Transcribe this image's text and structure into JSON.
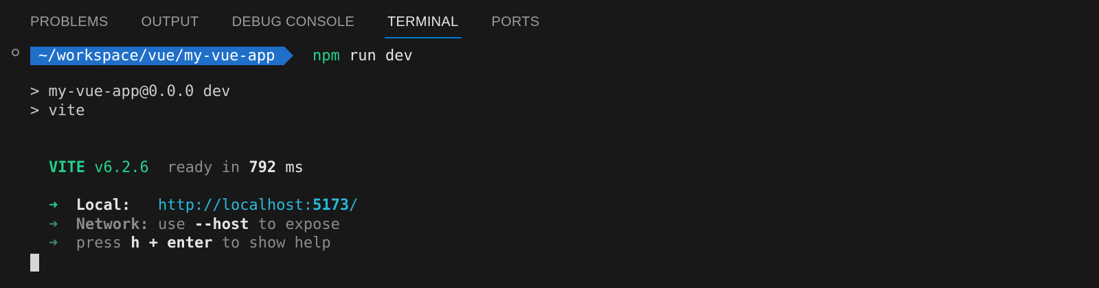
{
  "tabs": [
    {
      "label": "PROBLEMS",
      "active": false
    },
    {
      "label": "OUTPUT",
      "active": false
    },
    {
      "label": "DEBUG CONSOLE",
      "active": false
    },
    {
      "label": "TERMINAL",
      "active": true
    },
    {
      "label": "PORTS",
      "active": false
    }
  ],
  "terminal": {
    "prompt_path": "~/workspace/vue/my-vue-app",
    "command_bin": "npm",
    "command_args": " run dev",
    "script_line_1": "> my-vue-app@0.0.0 dev",
    "script_line_2": "> vite",
    "vite_name": "VITE",
    "vite_version": " v6.2.6",
    "ready_prefix": "  ready in ",
    "ready_ms": "792",
    "ready_unit": " ms",
    "local": {
      "arrow": "➜",
      "label": "Local:",
      "url_prefix": "http://localhost:",
      "url_port": "5173",
      "url_suffix": "/"
    },
    "network": {
      "arrow": "➜",
      "label": "Network:",
      "use": " use ",
      "flag": "--host",
      "rest": " to expose"
    },
    "help": {
      "arrow": "➜",
      "press": "press ",
      "keys": "h + enter",
      "rest": " to show help"
    }
  },
  "colors": {
    "background": "#181818",
    "accent_blue": "#1f6fc9",
    "tab_underline": "#0078d4",
    "green": "#23d18b",
    "cyan": "#29b8db"
  }
}
